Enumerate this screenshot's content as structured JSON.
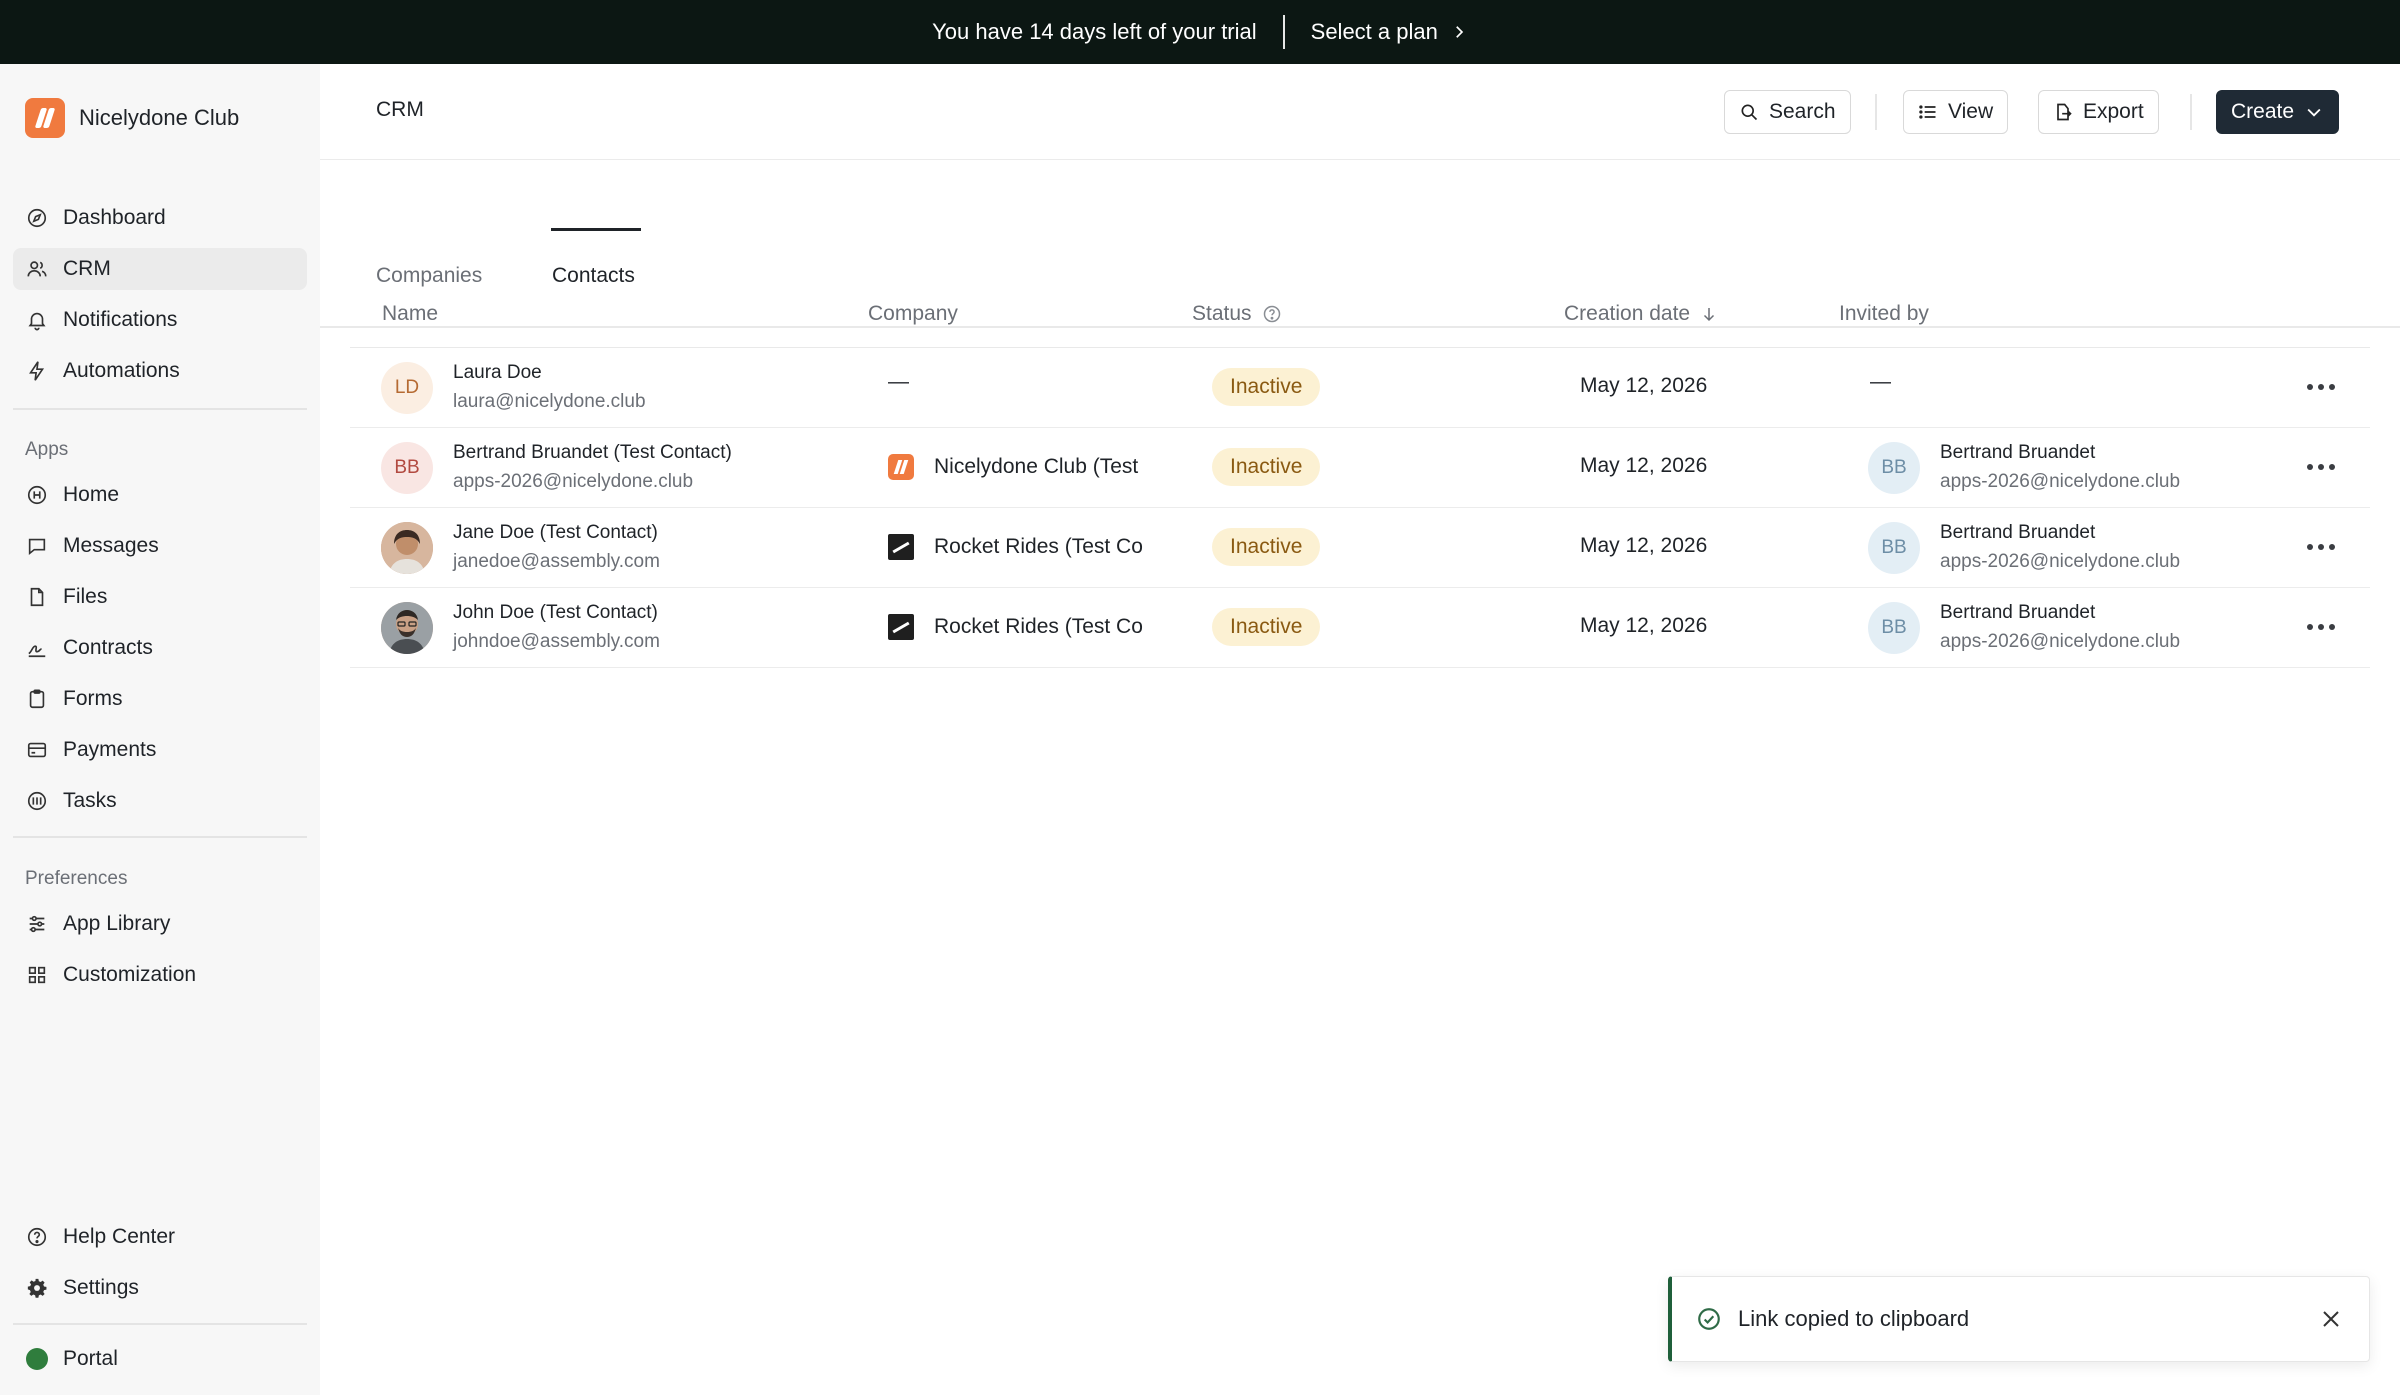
{
  "banner": {
    "trial_text": "You have 14 days left of your trial",
    "plan_label": "Select a plan"
  },
  "brand": {
    "name": "Nicelydone Club"
  },
  "sidebar": {
    "main_items": [
      {
        "label": "Dashboard",
        "icon": "compass-icon"
      },
      {
        "label": "CRM",
        "icon": "users-icon",
        "active": true
      },
      {
        "label": "Notifications",
        "icon": "bell-icon"
      },
      {
        "label": "Automations",
        "icon": "lightning-icon"
      }
    ],
    "apps_label": "Apps",
    "app_items": [
      {
        "label": "Home",
        "icon": "info-icon"
      },
      {
        "label": "Messages",
        "icon": "message-icon"
      },
      {
        "label": "Files",
        "icon": "file-icon"
      },
      {
        "label": "Contracts",
        "icon": "signature-icon"
      },
      {
        "label": "Forms",
        "icon": "clipboard-icon"
      },
      {
        "label": "Payments",
        "icon": "credit-card-icon"
      },
      {
        "label": "Tasks",
        "icon": "tasks-icon"
      }
    ],
    "preferences_label": "Preferences",
    "pref_items": [
      {
        "label": "App Library",
        "icon": "sliders-icon"
      },
      {
        "label": "Customization",
        "icon": "grid-icon"
      }
    ],
    "footer_items": [
      {
        "label": "Help Center",
        "icon": "help-icon"
      },
      {
        "label": "Settings",
        "icon": "gear-icon"
      }
    ],
    "portal_label": "Portal"
  },
  "header": {
    "title": "CRM",
    "search_label": "Search",
    "view_label": "View",
    "export_label": "Export",
    "create_label": "Create"
  },
  "tabs": [
    {
      "label": "Companies"
    },
    {
      "label": "Contacts",
      "active": true
    }
  ],
  "table": {
    "columns": {
      "name": "Name",
      "company": "Company",
      "status": "Status",
      "creation_date": "Creation date",
      "invited_by": "Invited by"
    },
    "rows": [
      {
        "initials": "LD",
        "name": "Laura Doe",
        "email": "laura@nicelydone.club",
        "company": "—",
        "status": "Inactive",
        "date": "May 12, 2026",
        "invited_by": "—"
      },
      {
        "initials": "BB",
        "name": "Bertrand Bruandet (Test Contact)",
        "email": "apps-2026@nicelydone.club",
        "company": "Nicelydone Club (Test",
        "status": "Inactive",
        "date": "May 12, 2026",
        "inviter_initials": "BB",
        "inviter_name": "Bertrand Bruandet",
        "inviter_email": "apps-2026@nicelydone.club"
      },
      {
        "name": "Jane Doe (Test Contact)",
        "email": "janedoe@assembly.com",
        "company": "Rocket Rides (Test Co",
        "status": "Inactive",
        "date": "May 12, 2026",
        "inviter_initials": "BB",
        "inviter_name": "Bertrand Bruandet",
        "inviter_email": "apps-2026@nicelydone.club"
      },
      {
        "name": "John Doe (Test Contact)",
        "email": "johndoe@assembly.com",
        "company": "Rocket Rides (Test Co",
        "status": "Inactive",
        "date": "May 12, 2026",
        "inviter_initials": "BB",
        "inviter_name": "Bertrand Bruandet",
        "inviter_email": "apps-2026@nicelydone.club"
      }
    ]
  },
  "toast": {
    "message": "Link copied to clipboard"
  }
}
